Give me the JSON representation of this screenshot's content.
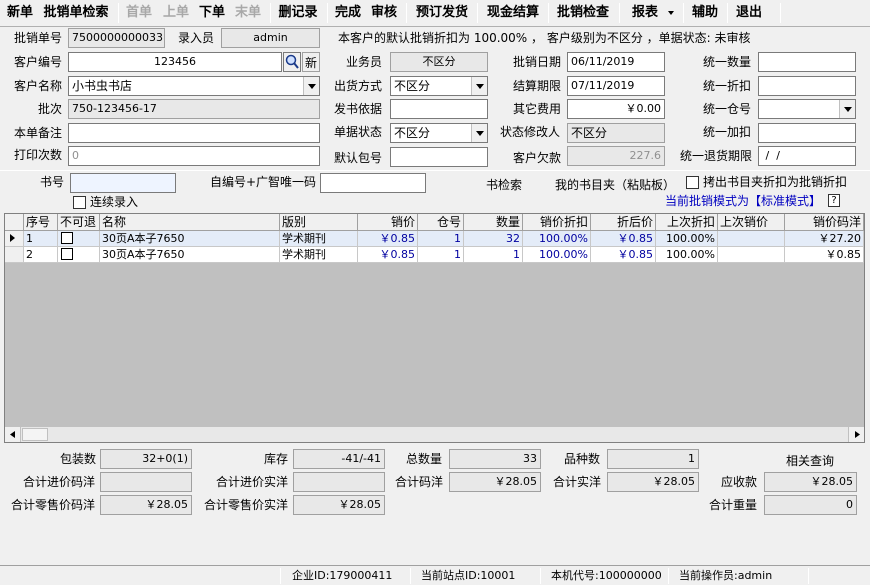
{
  "toolbar": {
    "new": "新单",
    "batch_search": "批销单检索",
    "first": "首单",
    "prev": "上单",
    "next": "下单",
    "last": "末单",
    "delete_record": "删记录",
    "finish": "完成",
    "review": "审核",
    "preorder_ship": "预订发货",
    "cash_settle": "现金结算",
    "batch_check": "批销检查",
    "report": "报表",
    "assist": "辅助",
    "exit": "退出"
  },
  "form": {
    "batch_no_label": "批销单号",
    "batch_no": "7500000000033",
    "entry_label": "录入员",
    "entry": "admin",
    "notice": "本客户的默认批销折扣为 100.00% ， 客户级别为不区分 ，单据状态: 未审核",
    "customer_no_label": "客户编号",
    "customer_no": "123456",
    "new_btn": "新",
    "salesman_label": "业务员",
    "salesman": "不区分",
    "batch_date_label": "批销日期",
    "batch_date": "06/11/2019",
    "unify_qty_label": "统一数量",
    "customer_name_label": "客户名称",
    "customer_name": "小书虫书店",
    "ship_method_label": "出货方式",
    "ship_method": "不区分",
    "settle_deadline_label": "结算期限",
    "settle_deadline": "07/11/2019",
    "unify_discount_label": "统一折扣",
    "batch_label": "批次",
    "batch": "750-123456-17",
    "ship_basis_label": "发书依据",
    "other_fee_label": "其它费用",
    "other_fee": "￥0.00",
    "unify_warehouse_label": "统一仓号",
    "remark_label": "本单备注",
    "doc_status_label": "单据状态",
    "doc_status": "不区分",
    "status_modifier_label": "状态修改人",
    "status_modifier": "不区分",
    "unify_markup_label": "统一加扣",
    "print_count_label": "打印次数",
    "print_count": "0",
    "default_pkg_label": "默认包号",
    "customer_debt_label": "客户欠款",
    "customer_debt": "227.6",
    "unify_return_label": "统一退货期限",
    "unify_return": " /  /",
    "book_no_label": "书号",
    "self_code_label": "自编号+广智唯一码",
    "book_search_label": "书检索",
    "my_folder_label": "我的书目夹（粘贴板）",
    "copy_discount_label": "拷出书目夹折扣为批销折扣",
    "continuous_entry_label": "连续录入",
    "mode_text": "当前批销模式为【标准模式】",
    "help": "?"
  },
  "grid": {
    "headers": [
      "序号",
      "不可退",
      "名称",
      "版别",
      "销价",
      "仓号",
      "数量",
      "销价折扣",
      "折后价",
      "上次折扣",
      "上次销价",
      "销价码洋"
    ],
    "rows": [
      [
        "1",
        "",
        "30页A本子7650",
        "学术期刊",
        "￥0.85",
        "1",
        "32",
        "100.00%",
        "￥0.85",
        "100.00%",
        "",
        "￥27.20"
      ],
      [
        "2",
        "",
        "30页A本子7650",
        "学术期刊",
        "￥0.85",
        "1",
        "1",
        "100.00%",
        "￥0.85",
        "100.00%",
        "",
        "￥0.85"
      ]
    ]
  },
  "summary": {
    "pkg_label": "包装数",
    "pkg": "32+0(1)",
    "stock_label": "库存",
    "stock": "-41/-41",
    "total_qty_label": "总数量",
    "total_qty": "33",
    "kinds_label": "品种数",
    "kinds": "1",
    "related_query": "相关查询",
    "total_purchase_code_label": "合计进价码洋",
    "total_purchase_real_label": "合计进价实洋",
    "total_code_label": "合计码洋",
    "total_code": "￥28.05",
    "total_real_label": "合计实洋",
    "total_real": "￥28.05",
    "receivable_label": "应收款",
    "receivable": "￥28.05",
    "total_retail_code_label": "合计零售价码洋",
    "total_retail_code": "￥28.05",
    "total_retail_real_label": "合计零售价实洋",
    "total_retail_real": "￥28.05",
    "total_weight_label": "合计重量",
    "total_weight": "0"
  },
  "status": {
    "company": "企业ID:179000411",
    "site": "当前站点ID:10001",
    "machine": "本机代号:100000000",
    "operator": "当前操作员:admin"
  }
}
